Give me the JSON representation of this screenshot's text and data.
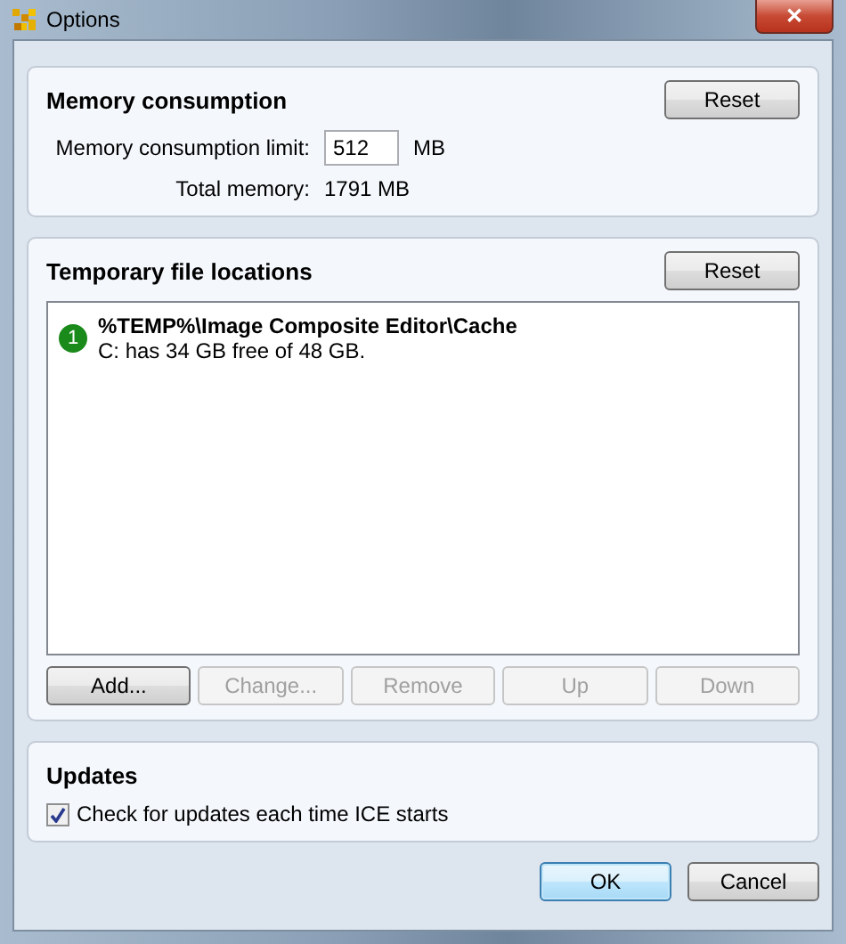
{
  "window": {
    "title": "Options",
    "close": "✕"
  },
  "memory": {
    "title": "Memory consumption",
    "reset": "Reset",
    "limit_label": "Memory consumption limit:",
    "limit_value": "512",
    "limit_unit": "MB",
    "total_label": "Total memory:",
    "total_value": "1791 MB"
  },
  "temp": {
    "title": "Temporary file locations",
    "reset": "Reset",
    "locations": [
      {
        "index": "1",
        "path": "%TEMP%\\Image Composite Editor\\Cache",
        "info": "C: has 34 GB free of 48 GB.",
        "color": "#1a8a1a"
      }
    ],
    "buttons": [
      {
        "label": "Add...",
        "disabled": false
      },
      {
        "label": "Change...",
        "disabled": true
      },
      {
        "label": "Remove",
        "disabled": true
      },
      {
        "label": "Up",
        "disabled": true
      },
      {
        "label": "Down",
        "disabled": true
      }
    ]
  },
  "updates": {
    "title": "Updates",
    "check_label": "Check for updates each time ICE starts",
    "checked": true
  },
  "footer": [
    {
      "label": "OK",
      "default": true
    },
    {
      "label": "Cancel",
      "default": false
    }
  ]
}
